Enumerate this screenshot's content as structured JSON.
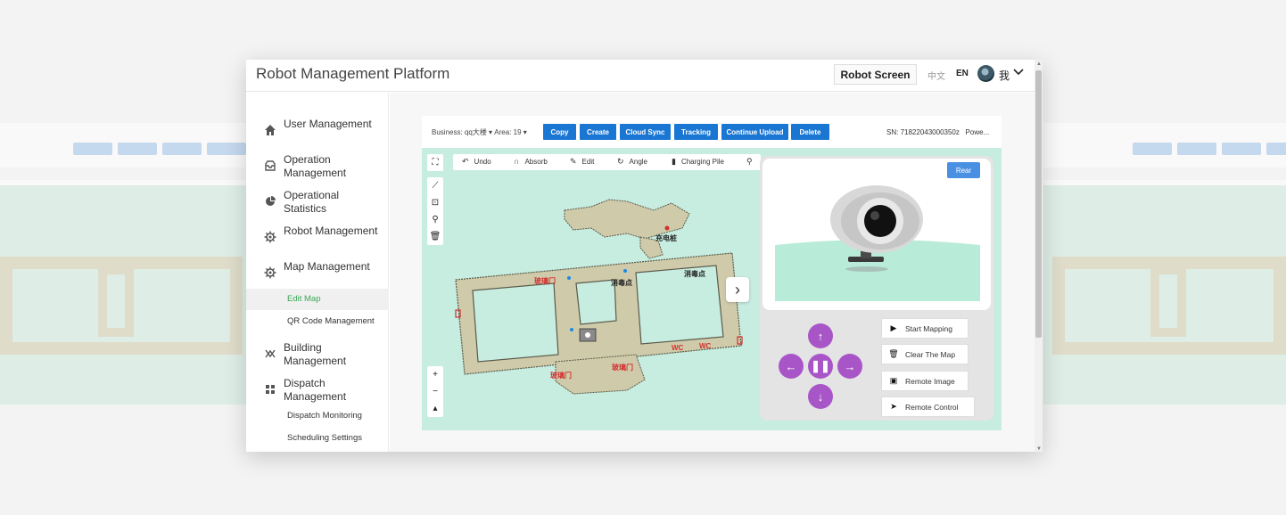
{
  "header": {
    "title": "Robot Management Platform",
    "robot_screen": "Robot Screen",
    "lang_zh": "中文",
    "lang_en": "EN",
    "user": "我"
  },
  "sidebar": {
    "items": [
      {
        "label": "User Management",
        "icon": "home-icon"
      },
      {
        "label": "Operation Management",
        "icon": "inbox-icon"
      },
      {
        "label": "Operational Statistics",
        "icon": "pie-chart-icon"
      },
      {
        "label": "Robot Management",
        "icon": "gear-icon"
      },
      {
        "label": "Map Management",
        "icon": "gear-icon"
      },
      {
        "label": "Building Management",
        "icon": "building-icon"
      },
      {
        "label": "Dispatch Management",
        "icon": "grid-icon"
      }
    ],
    "map_sub": [
      "Edit Map",
      "QR Code Management"
    ],
    "dispatch_sub": [
      "Dispatch Monitoring",
      "Scheduling Settings"
    ],
    "active_sub": "Edit Map"
  },
  "toolbar": {
    "business_label": "Business:",
    "business_value": "qq大楼",
    "area_label": "Area:",
    "area_value": "19",
    "buttons": [
      "Copy",
      "Create",
      "Cloud Sync",
      "Tracking",
      "Continue Upload",
      "Delete"
    ],
    "sn_label": "SN:",
    "sn_value": "71822043000350z",
    "power_truncated": "Powe..."
  },
  "map_tools": {
    "undo": "Undo",
    "absorb": "Absorb",
    "edit": "Edit",
    "angle": "Angle",
    "charging_pile": "Charging Pile"
  },
  "map_labels": {
    "charging": "充电桩",
    "disinfect": "消毒点",
    "glass_door": "玻璃门",
    "wc": "WC"
  },
  "control": {
    "rear": "Rear",
    "actions": [
      "Start Mapping",
      "Clear The Map",
      "Remote Image",
      "Remote Control"
    ]
  },
  "colors": {
    "primary_blue": "#1976d2",
    "accent_purple": "#a855c8",
    "map_bg": "#c7ece0",
    "active_green": "#3aa757"
  }
}
